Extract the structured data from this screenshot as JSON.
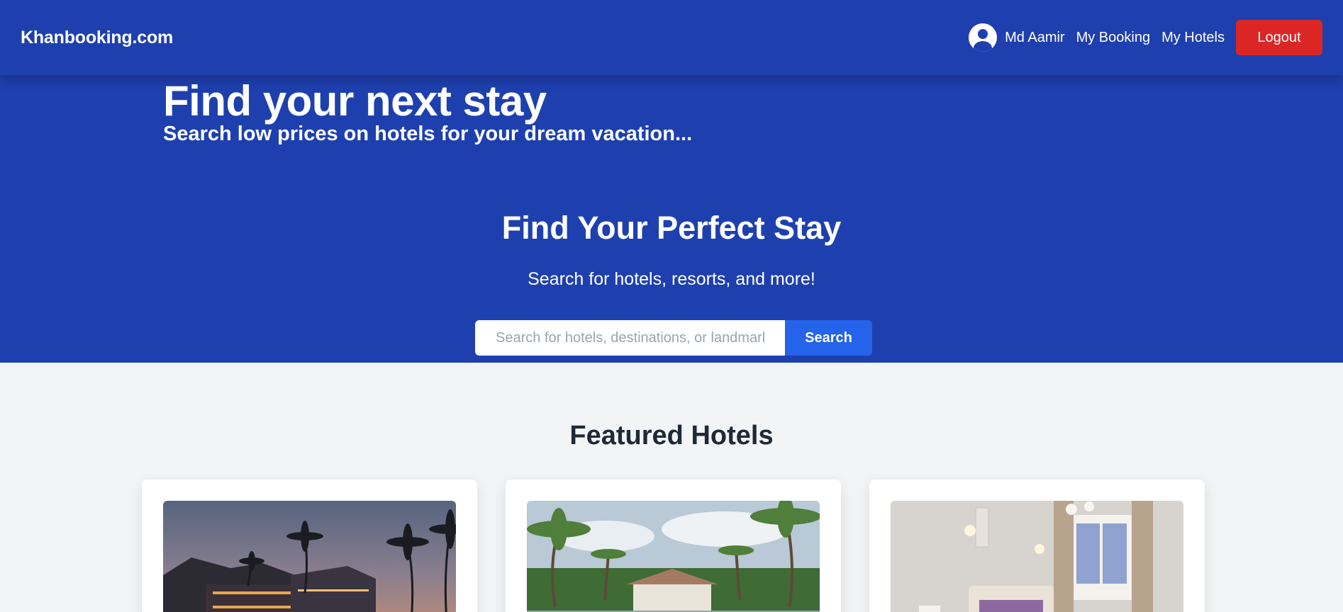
{
  "header": {
    "logo": "Khanbooking.com",
    "user_name": "Md Aamir",
    "nav": [
      "My Booking",
      "My Hotels"
    ],
    "logout_label": "Logout"
  },
  "hero": {
    "title": "Find your next stay",
    "subtitle": "Search low prices on hotels for your dream vacation..."
  },
  "search_section": {
    "title": "Find Your Perfect Stay",
    "subtitle": "Search for hotels, resorts, and more!",
    "placeholder": "Search for hotels, destinations, or landmarks",
    "button_label": "Search"
  },
  "featured": {
    "title": "Featured Hotels",
    "cards": [
      {
        "image": "resort-palm-trees-dusk"
      },
      {
        "image": "pool-gazebo-palm-trees"
      },
      {
        "image": "bedroom-interior"
      }
    ]
  },
  "colors": {
    "primary": "#1e40af",
    "search_button": "#2563eb",
    "logout": "#dc2626",
    "page_bg": "#f3f4f6"
  }
}
